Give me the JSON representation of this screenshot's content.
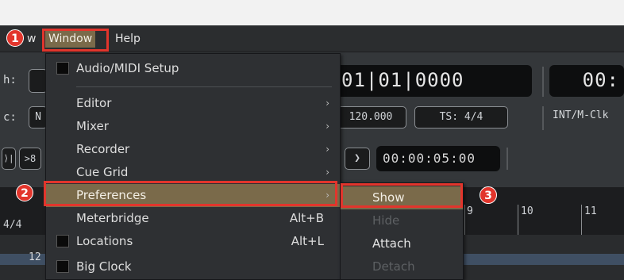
{
  "menubar": {
    "partial_left": "w",
    "window": "Window",
    "help": "Help"
  },
  "transport": {
    "punch_label": "h:",
    "sync_label": "c:",
    "sync_value_partial": "N",
    "primary_clock": "01|01|0000",
    "secondary_clock_partial": "00:",
    "tempo": "120.000",
    "time_signature": "TS: 4/4",
    "clock_source_partial": "INT/M-Clk",
    "nudge_clock": "00:00:05:00",
    "forward_glyph": "❯",
    "cut_glyph": ">8",
    "prev_glyph": "⟩|"
  },
  "ruler": {
    "markers": [
      "9",
      "10",
      "11"
    ],
    "meter": "4/4",
    "region_partial": "12"
  },
  "window_menu": {
    "items": [
      {
        "label": "Audio/MIDI Setup",
        "checkbox": true
      },
      {
        "label": "Editor",
        "submenu": true
      },
      {
        "label": "Mixer",
        "submenu": true
      },
      {
        "label": "Recorder",
        "submenu": true
      },
      {
        "label": "Cue Grid",
        "submenu": true
      },
      {
        "label": "Preferences",
        "submenu": true,
        "highlighted": true
      },
      {
        "label": "Meterbridge",
        "shortcut": "Alt+B"
      },
      {
        "label": "Locations",
        "shortcut": "Alt+L",
        "checkbox": true
      },
      {
        "label": "Big Clock",
        "checkbox": true
      }
    ],
    "arrow_glyph": "›"
  },
  "preferences_submenu": {
    "items": [
      {
        "label": "Show",
        "highlighted": true
      },
      {
        "label": "Hide",
        "disabled": true
      },
      {
        "label": "Attach"
      },
      {
        "label": "Detach",
        "disabled": true
      }
    ]
  },
  "annotations": {
    "step1": "1",
    "step2": "2",
    "step3": "3",
    "color": "#e2352c"
  },
  "colors": {
    "highlight": "#7a6a4a",
    "menu_bg": "#2e3033",
    "app_bg": "#34373a"
  }
}
